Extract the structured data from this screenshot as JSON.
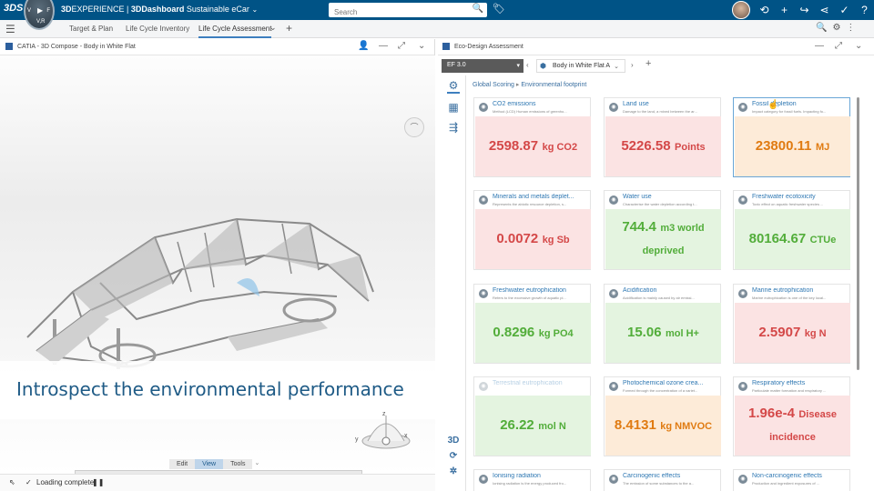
{
  "topbar": {
    "logo": "3DS",
    "compass": {
      "v": "V",
      "play": "▶",
      "f": "F",
      "s": "V,R",
      "top": "3D"
    },
    "brand_prefix": "3D",
    "brand_mid": "EXPERIENCE | ",
    "brand_dash": "3DDashboard",
    "brand_dash_name": " Sustainable eCar",
    "brand_chevron": "⌄",
    "search_placeholder": "Search",
    "search_icon": "🔍",
    "tag_icon": "🏷",
    "icons": [
      "share-icon",
      "plus-icon",
      "forward-icon",
      "network-icon",
      "tools-icon",
      "help-icon"
    ],
    "icon_glyphs": [
      "⟲",
      "+",
      "↪",
      "⋖",
      "✓",
      "?"
    ]
  },
  "tabbar": {
    "menu_icon": "☰",
    "tabs": [
      "Target & Plan",
      "Life Cycle Inventory",
      "Life Cycle Assessment"
    ],
    "active_tab": "Life Cycle Assessment",
    "chevron": "⌄",
    "plus": "+",
    "right_icons": [
      "🔍",
      "⚙",
      "⋮"
    ]
  },
  "left_panel": {
    "title": "CATIA - 3D Compose - Body in White Flat",
    "controls": [
      "👤",
      "—",
      "⤢",
      "⌄"
    ],
    "caption": "Introspect the environmental performance",
    "edit_tabs": [
      "Edit",
      "View",
      "Tools"
    ],
    "edit_active": "View",
    "edit_chevron": "⌄",
    "action_icons": [
      "📦",
      "▭",
      "⌂",
      "▢",
      "🔍",
      "✥",
      "⟲",
      "⌕",
      "⚙",
      "⧉",
      "▦",
      "⤡",
      "✕",
      "ⓘ"
    ],
    "compass_labels": {
      "z": "z",
      "y": "y",
      "x": "x"
    },
    "status_text": "Loading complete",
    "status_check": "✓",
    "status_pause": "❚❚",
    "status_left_icon": "⇖"
  },
  "right_panel": {
    "title": "Eco-Design Assessment",
    "controls": [
      "—",
      "⤢",
      "⌄"
    ],
    "method": "EF 3.0",
    "method_dd": "▾",
    "nav_left": "‹",
    "nav_right": "›",
    "product": "Body in White Flat A",
    "product_dd": "⌄",
    "plus": "+",
    "side_icons": [
      "⚙",
      "▦",
      "⇶"
    ],
    "side_bottom": [
      "3D",
      "⟳",
      "✲"
    ],
    "breadcrumb": [
      "Global Scoring",
      "Environmental footprint"
    ],
    "breadcrumb_sep": "▸",
    "cards": [
      {
        "name": "CO2 emissions",
        "desc": "Method (LCD) Human emissions of greenho...",
        "value": "2598.87",
        "unit": "kg CO2",
        "status": "red"
      },
      {
        "name": "Land use",
        "desc": "Damage to the land, a mixed between the ar...",
        "value": "5226.58",
        "unit": "Points",
        "status": "red"
      },
      {
        "name": "Fossil depletion",
        "desc": "Impact category for fossil fuels. Impacting fo...",
        "value": "23800.11",
        "unit": "MJ",
        "status": "orange"
      },
      {
        "name": "Minerals and metals deplet...",
        "desc": "Represents the abiotic resource depletion, s...",
        "value": "0.0072",
        "unit": "kg Sb",
        "status": "red"
      },
      {
        "name": "Water use",
        "desc": "Characterise the water depletion according t...",
        "value": "744.4",
        "unit": "m3 world deprived",
        "status": "green"
      },
      {
        "name": "Freshwater ecotoxicity",
        "desc": "Toxic effect on aquatic freshwater species ...",
        "value": "80164.67",
        "unit": "CTUe",
        "status": "green"
      },
      {
        "name": "Freshwater eutrophication",
        "desc": "Refers to the excessive growth of aquatic pl...",
        "value": "0.8296",
        "unit": "kg PO4",
        "status": "green"
      },
      {
        "name": "Acidification",
        "desc": "Acidification is mainly caused by air emissi...",
        "value": "15.06",
        "unit": "mol H+",
        "status": "green"
      },
      {
        "name": "Marine eutrophication",
        "desc": "Marine eutrophication is one of the key local...",
        "value": "2.5907",
        "unit": "kg N",
        "status": "red"
      },
      {
        "name": "Terrestrial eutrophication",
        "desc": "",
        "value": "26.22",
        "unit": "mol N",
        "status": "green"
      },
      {
        "name": "Photochemical ozone crea...",
        "desc": "Formed through the concentration of a variet...",
        "value": "8.4131",
        "unit": "kg NMVOC",
        "status": "orange"
      },
      {
        "name": "Respiratory effects",
        "desc": "Particulate matter formation and respiratory ...",
        "value": "1.96e-4",
        "unit": "Disease incidence",
        "status": "red"
      },
      {
        "name": "Ionising radiation",
        "desc": "Ionising radiation is the energy produced fro...",
        "value": "",
        "unit": "",
        "status": "red"
      },
      {
        "name": "Carcinogenic effects",
        "desc": "The emission of some substances to the a...",
        "value": "",
        "unit": "",
        "status": "red"
      },
      {
        "name": "Non-carcinogenic effects",
        "desc": "Production and ingredient exposures of ...",
        "value": "",
        "unit": "",
        "status": "red"
      }
    ]
  },
  "colors": {
    "brand_bar": "#005386",
    "red_text": "#d44848",
    "green_text": "#52ad3a",
    "orange_text": "#e07b12",
    "link": "#2f78b3"
  }
}
